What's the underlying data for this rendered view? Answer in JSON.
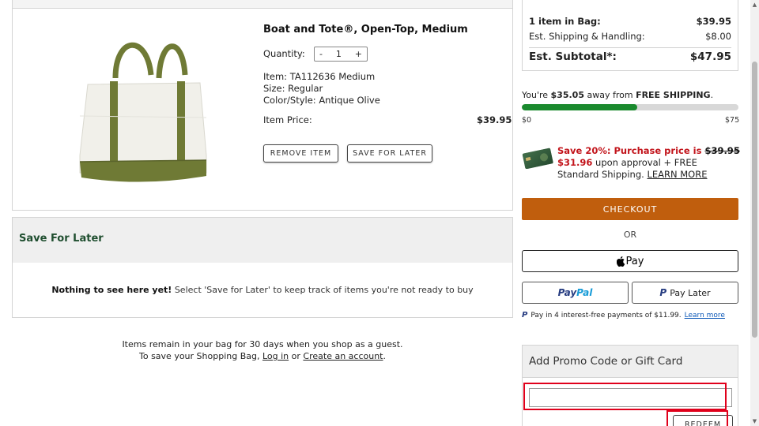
{
  "product": {
    "title": "Boat and Tote®, Open-Top, Medium",
    "quantity_label": "Quantity:",
    "quantity_minus": "-",
    "quantity_value": "1",
    "quantity_plus": "+",
    "item": "Item: TA112636 Medium",
    "size": "Size: Regular",
    "color_style": "Color/Style: Antique Olive",
    "item_price_label": "Item Price:",
    "item_price_value": "$39.95",
    "remove_label": "REMOVE ITEM",
    "save_later_label": "SAVE FOR LATER"
  },
  "save_for_later": {
    "title": "Save For Later",
    "empty_bold": "Nothing to see here yet!",
    "empty_text": " Select 'Save for Later' to keep track of items you're not ready to buy"
  },
  "guest_note": {
    "line1": "Items remain in your bag for 30 days when you shop as a guest.",
    "line2_prefix": "To save your Shopping Bag, ",
    "login_link": "Log in",
    "line2_mid": " or ",
    "create_link": "Create an account",
    "line2_suffix": "."
  },
  "summary": {
    "items_label": "1 item in Bag:",
    "items_value": "$39.95",
    "shipping_label": "Est. Shipping & Handling:",
    "shipping_value": "$8.00",
    "subtotal_label": "Est. Subtotal*:",
    "subtotal_value": "$47.95"
  },
  "free_shipping": {
    "prefix": "You're ",
    "amount": "$35.05",
    "middle": " away from ",
    "emphasis": "FREE SHIPPING",
    "suffix": ".",
    "min_label": "$0",
    "max_label": "$75",
    "progress_fraction": 0.533,
    "fill_color": "#1a8a2e"
  },
  "card_offer": {
    "headline": "Save 20%: Purchase price is ",
    "original_price": "$39.95",
    "discount_price": "$31.96",
    "rest": " upon approval + FREE Standard Shipping. ",
    "learn_more": "LEARN MORE"
  },
  "checkout": {
    "checkout_label": "CHECKOUT",
    "checkout_color": "#c05e0d",
    "or_label": "OR",
    "applepay_glyph": "",
    "applepay_label": "Pay",
    "paypal_pay": "Pay",
    "paypal_pal": "Pal",
    "paylater_glyph": "P",
    "paylater_label": "Pay Later",
    "pay4_text": "Pay in 4 interest-free payments of $11.99.",
    "pay4_link": "Learn more"
  },
  "gift": {
    "title": "Add Promo Code or Gift Card",
    "input_value": "",
    "redeem_label": "REDEEM"
  },
  "colors": {
    "highlight": "#e0001b",
    "sfl_title": "#1f4e2f",
    "offer_red": "#c2141b"
  }
}
